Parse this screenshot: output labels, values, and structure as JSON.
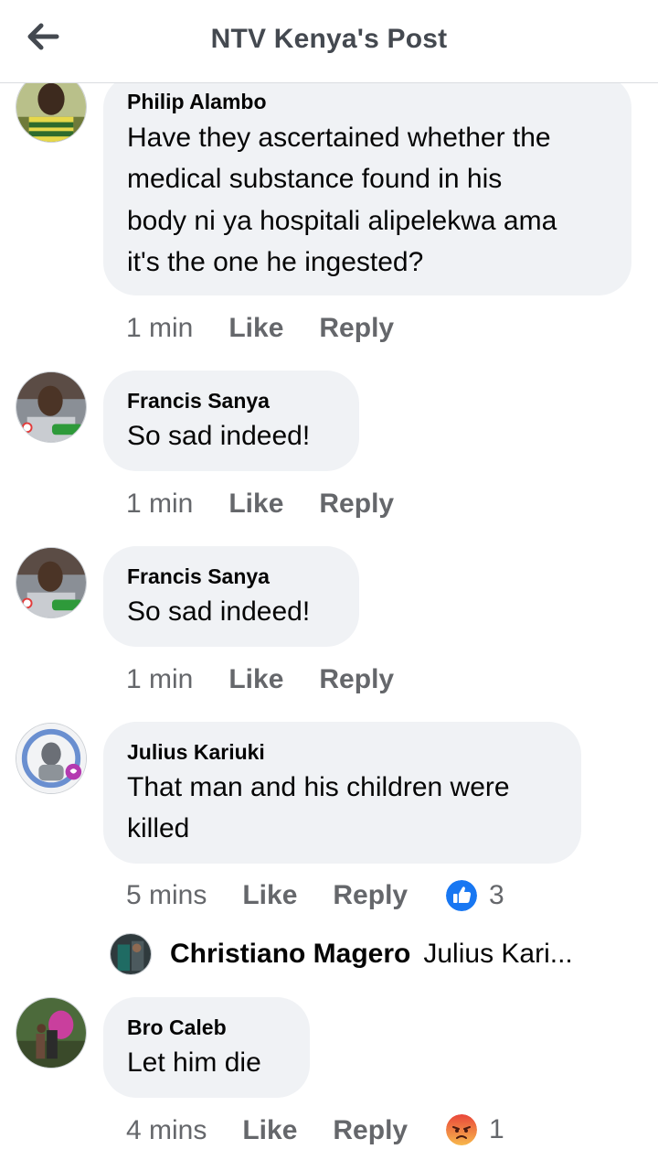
{
  "header": {
    "title": "NTV Kenya's Post",
    "back_icon": "arrow-left-icon"
  },
  "colors": {
    "bubble_bg": "#f0f2f5",
    "meta_text": "#65676b",
    "like_blue": "#1877f2",
    "angry_orange": "#f7714c"
  },
  "comments": [
    {
      "author": "Philip Alambo",
      "lines": [
        "Have they ascertained whether the",
        "medical substance found in his",
        "body ni ya hospitali alipelekwa ama",
        "it's the one he ingested?"
      ],
      "time": "1 min",
      "like": "Like",
      "reply": "Reply"
    },
    {
      "author": "Francis Sanya",
      "lines": [
        " So sad indeed!"
      ],
      "time": "1 min",
      "like": "Like",
      "reply": "Reply"
    },
    {
      "author": "Francis Sanya",
      "lines": [
        " So sad indeed!"
      ],
      "time": "1 min",
      "like": "Like",
      "reply": "Reply"
    },
    {
      "author": "Julius Kariuki",
      "lines": [
        "That man and his children were",
        "killed"
      ],
      "time": "5 mins",
      "like": "Like",
      "reply": "Reply",
      "reaction_icon": "like-reaction-icon",
      "reaction_count": "3",
      "reply_preview": {
        "author": "Christiano Magero",
        "text": "Julius Kari..."
      }
    },
    {
      "author": "Bro Caleb",
      "lines": [
        "Let him die"
      ],
      "time": "4 mins",
      "like": "Like",
      "reply": "Reply",
      "reaction_icon": "angry-reaction-icon",
      "reaction_count": "1"
    }
  ]
}
